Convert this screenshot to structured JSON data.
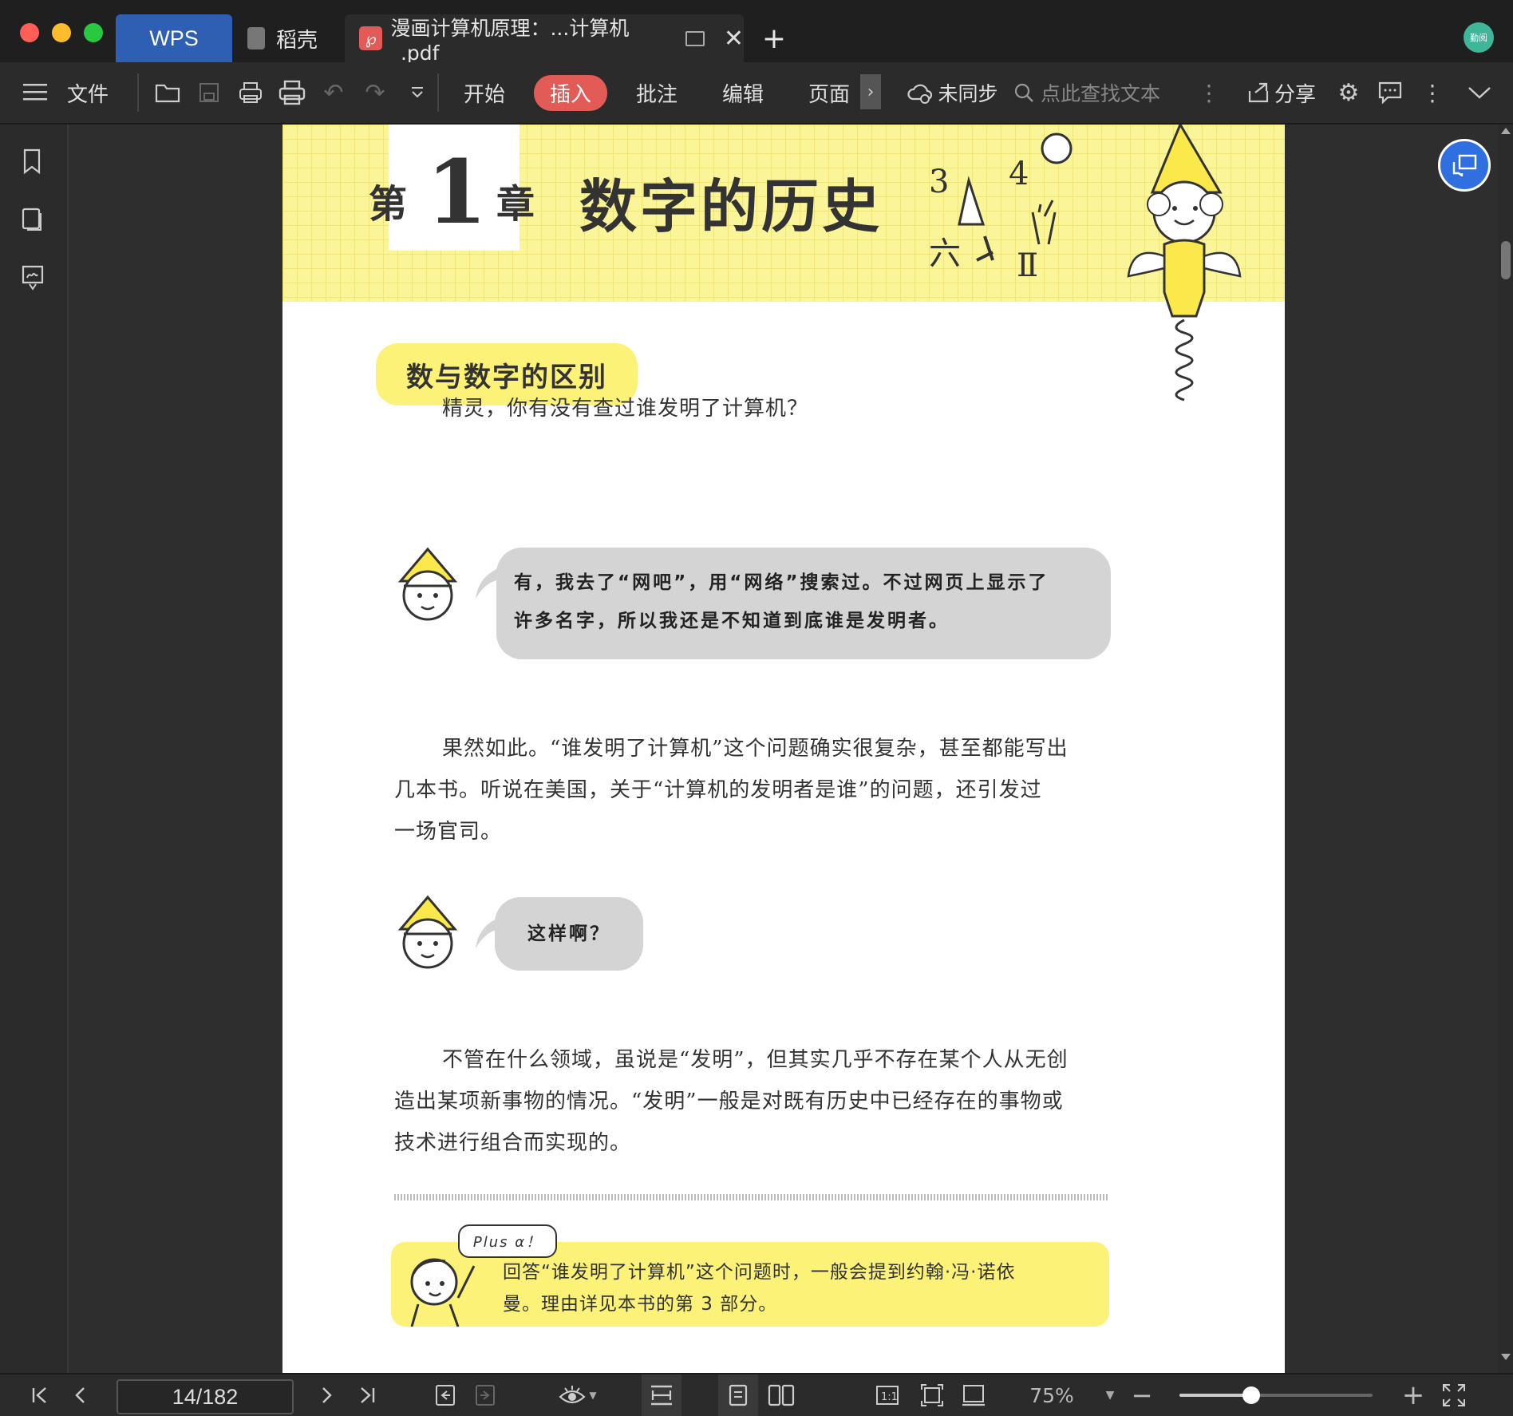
{
  "titlebar": {
    "tabs": [
      {
        "label": "WPS"
      },
      {
        "label": "稻壳"
      },
      {
        "label": "漫画计算机原理：...计算机_.pdf"
      }
    ],
    "avatar_text": "勤阅"
  },
  "toolbar": {
    "file_label": "文件",
    "menu": [
      "开始",
      "插入",
      "批注",
      "编辑",
      "页面"
    ],
    "active_menu": "插入",
    "sync_label": "未同步",
    "search_placeholder": "点此查找文本",
    "share_label": "分享"
  },
  "document": {
    "chapter_prefix": "第",
    "chapter_number": "1",
    "chapter_suffix": "章",
    "chapter_title": "数字的历史",
    "section_title": "数与数字的区别",
    "para1": "精灵，你有没有查过谁发明了计算机？",
    "bubble1_line1": "有，我去了“网吧”，用“网络”搜索过。不过网页上显示了",
    "bubble1_line2": "许多名字，所以我还是不知道到底谁是发明者。",
    "para2_line1": "果然如此。“谁发明了计算机”这个问题确实很复杂，甚至都能写出",
    "para2_line2": "几本书。听说在美国，关于“计算机的发明者是谁”的问题，还引发过",
    "para2_line3": "一场官司。",
    "bubble2": "这样啊？",
    "para3_line1": "不管在什么领域，虽说是“发明”，但其实几乎不存在某个人从无创",
    "para3_line2": "造出某项新事物的情况。“发明”一般是对既有历史中已经存在的事物或",
    "para3_line3": "技术进行组合而实现的。",
    "plus_label": "Plus α！",
    "note_line1": "回答“谁发明了计算机”这个问题时，一般会提到约翰·冯·诺依",
    "note_line2": "曼。理由详见本书的第 3 部分。"
  },
  "statusbar": {
    "page_indicator": "14/182",
    "zoom": "75%",
    "zoom_fraction": 0.37
  },
  "colors": {
    "accent_red": "#e25b57",
    "header_yellow": "#fbf59a",
    "note_yellow": "#fcf277"
  }
}
